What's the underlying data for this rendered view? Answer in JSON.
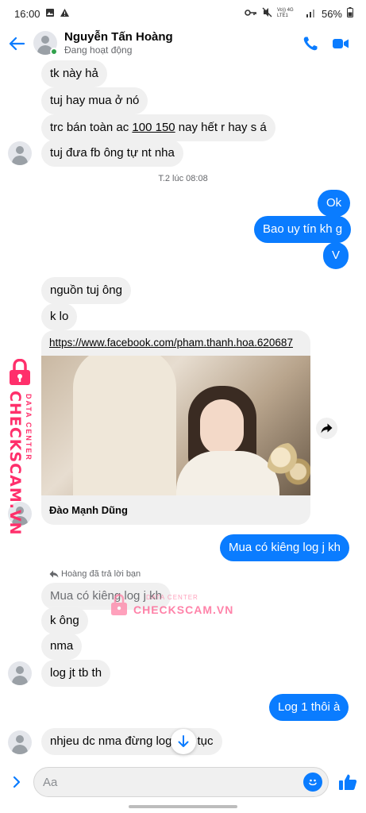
{
  "status_bar": {
    "time": "16:00",
    "network_label": "Vo)) 4G LTE1",
    "battery": "56%"
  },
  "header": {
    "contact_name": "Nguyễn Tấn Hoàng",
    "status": "Đang hoạt động"
  },
  "messages": [
    {
      "text": "tk này hả"
    },
    {
      "text": "tuj hay mua ở nó"
    },
    {
      "text_before": "trc bán toàn ac ",
      "text_underlined": "100 150",
      "text_after": " nay hết r hay s á"
    },
    {
      "text": "tuj đưa fb ông tự nt nha"
    },
    {
      "text": "Ok"
    },
    {
      "text": "Bao uy tín kh g"
    },
    {
      "text": "V"
    },
    {
      "text": "nguồn tuj ông"
    },
    {
      "text": "k lo"
    },
    {
      "text": "Mua có kiêng log j kh"
    },
    {
      "text": "Mua có kiêng log j kh"
    },
    {
      "text": "k ông"
    },
    {
      "text": "nma"
    },
    {
      "text": "log jt tb th"
    },
    {
      "text": "Log 1 thôi à"
    },
    {
      "text_before": "nhjeu dc nma đừng log",
      "text_after": "tục"
    }
  ],
  "timestamp": "T.2 lúc 08:08",
  "link_preview": {
    "url": "https://www.facebook.com/pham.thanh.hoa.620687",
    "title": "Đào Mạnh Dũng"
  },
  "reply_label": "Hoàng đã trả lời bạn",
  "composer": {
    "placeholder": "Aa"
  },
  "watermark": {
    "brand": "CHECKSCAM.VN",
    "sub": "DATA CENTER"
  },
  "colors": {
    "accent": "#0a7cff",
    "incoming_bubble": "#f0f0f0",
    "watermark": "#ff2f6b"
  },
  "icons": [
    "back-arrow-icon",
    "phone-icon",
    "video-camera-icon",
    "share-arrow-icon",
    "arrow-down-icon",
    "chevron-right-icon",
    "emoji-icon",
    "thumbs-up-icon",
    "reply-icon",
    "lock-icon"
  ]
}
